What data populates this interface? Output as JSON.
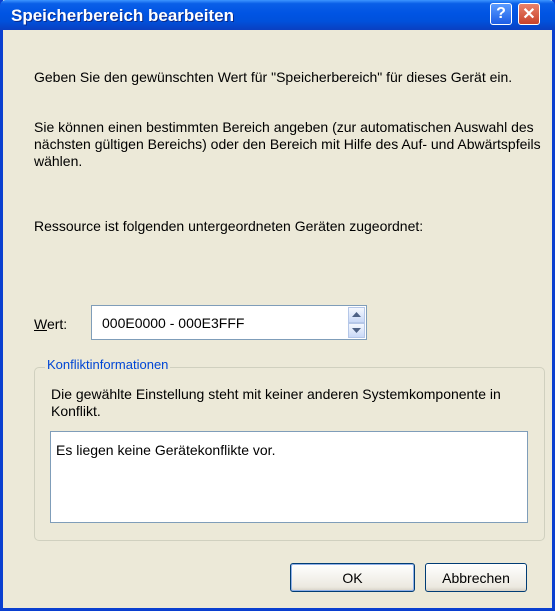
{
  "window": {
    "title": "Speicherbereich bearbeiten"
  },
  "titlebar_buttons": {
    "help": "?",
    "close": "✕"
  },
  "description": {
    "p1": "Geben Sie den gewünschten Wert für \"Speicherbereich\" für dieses Gerät ein.",
    "p2": "Sie können einen bestimmten Bereich angeben (zur automatischen Auswahl des nächsten gültigen Bereichs) oder den Bereich mit Hilfe des Auf- und Abwärtspfeils wählen.",
    "p3": "Ressource ist folgenden untergeordneten Geräten zugeordnet:"
  },
  "value": {
    "label_access": "W",
    "label_rest": "ert:",
    "text": "000E0000 - 000E3FFF"
  },
  "conflict": {
    "legend": "Konfliktinformationen",
    "description": "Die gewählte Einstellung steht mit keiner anderen Systemkomponente in Konflikt.",
    "list_text": "Es liegen keine Gerätekonflikte vor."
  },
  "buttons": {
    "ok": "OK",
    "cancel": "Abbrechen"
  },
  "colors": {
    "titlebar": "#0054e3",
    "legend": "#0046d5",
    "face": "#ece9d8"
  }
}
